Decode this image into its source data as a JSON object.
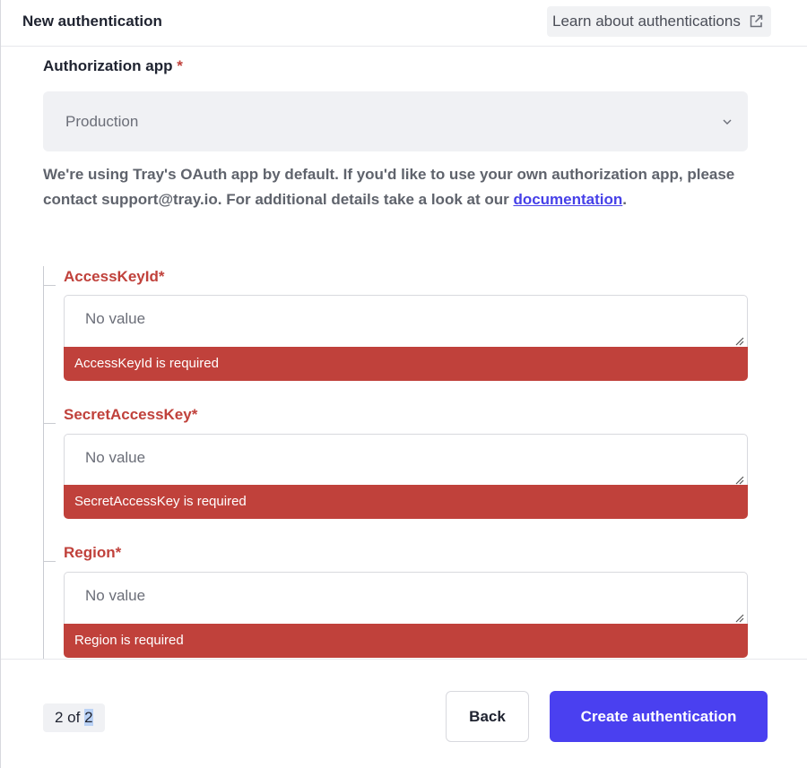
{
  "header": {
    "title": "New authentication",
    "learn_link": "Learn about authentications"
  },
  "authorization": {
    "label": "Authorization app",
    "required_mark": "*",
    "selected": "Production",
    "info_text": "We're using Tray's OAuth app by default. If you'd like to use your own authorization app, please contact support@tray.io. For additional details take a look at our",
    "info_link": "documentation",
    "info_end": "."
  },
  "fields": [
    {
      "label": "AccessKeyId*",
      "placeholder": "No value",
      "error": "AccessKeyId is required"
    },
    {
      "label": "SecretAccessKey*",
      "placeholder": "No value",
      "error": "SecretAccessKey is required"
    },
    {
      "label": "Region*",
      "placeholder": "No value",
      "error": "Region is required"
    }
  ],
  "footer": {
    "pager_prefix": "2 of ",
    "pager_total": "2",
    "back_label": "Back",
    "create_label": "Create authentication"
  },
  "colors": {
    "accent": "#4a40f0",
    "error": "#c0413b",
    "link": "#4640e8"
  },
  "icons": {
    "external_link": "external-link-icon",
    "chevron": "chevron-down-icon",
    "resize": "resize-grip-icon"
  }
}
